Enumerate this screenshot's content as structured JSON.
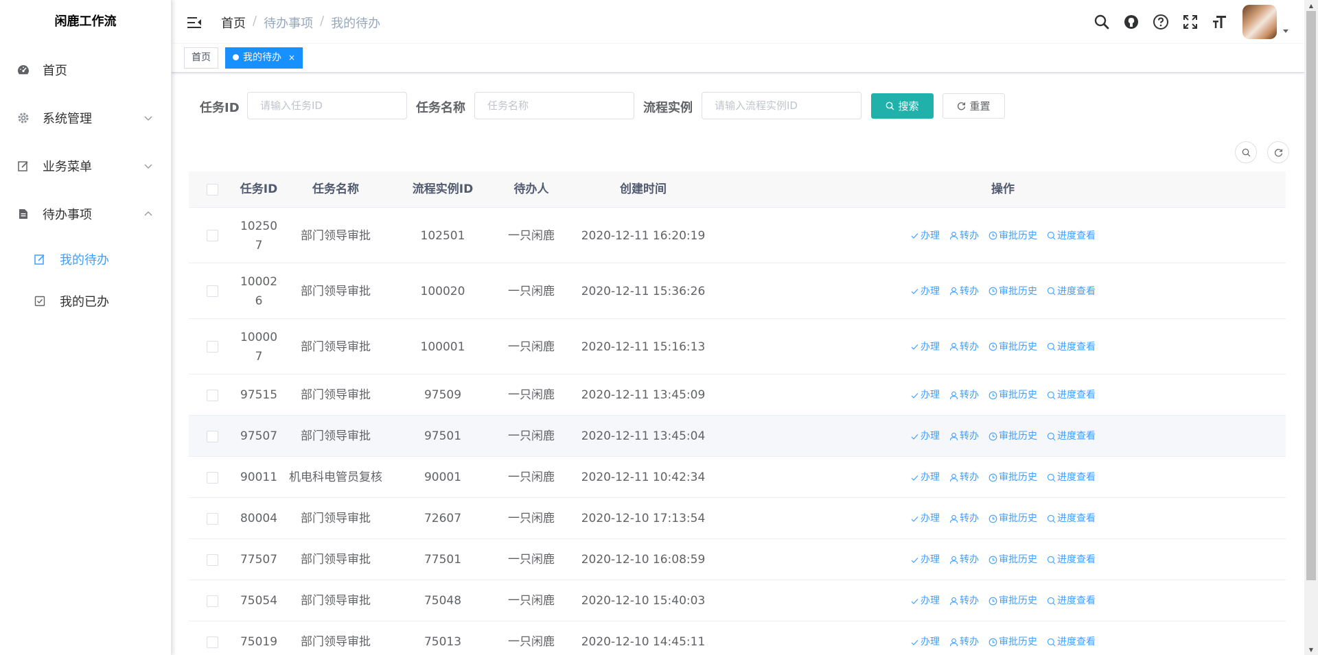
{
  "app": {
    "title": "闲鹿工作流"
  },
  "sidebar": {
    "items": [
      {
        "label": "首页"
      },
      {
        "label": "系统管理"
      },
      {
        "label": "业务菜单"
      },
      {
        "label": "待办事项"
      }
    ],
    "sub_items": [
      {
        "label": "我的待办",
        "active": true
      },
      {
        "label": "我的已办",
        "active": false
      }
    ]
  },
  "breadcrumb": [
    "首页",
    "待办事项",
    "我的待办"
  ],
  "tags": {
    "home": "首页",
    "active": "我的待办",
    "close": "×"
  },
  "search": {
    "task_id_label": "任务ID",
    "task_id_placeholder": "请输入任务ID",
    "task_name_label": "任务名称",
    "task_name_placeholder": "任务名称",
    "proc_inst_label": "流程实例",
    "proc_inst_placeholder": "请输入流程实例ID",
    "search_button": "搜索",
    "reset_button": "重置"
  },
  "table": {
    "headers": {
      "task_id": "任务ID",
      "task_name": "任务名称",
      "proc_inst_id": "流程实例ID",
      "assignee": "待办人",
      "create_time": "创建时间",
      "actions": "操作"
    },
    "action_labels": {
      "handle": "办理",
      "transfer": "转办",
      "history": "审批历史",
      "progress": "进度查看"
    },
    "rows": [
      {
        "task_id_lines": [
          "10250",
          "7"
        ],
        "task_name": "部门领导审批",
        "proc_inst_id": "102501",
        "assignee": "一只闲鹿",
        "create_time": "2020-12-11 16:20:19"
      },
      {
        "task_id_lines": [
          "10002",
          "6"
        ],
        "task_name": "部门领导审批",
        "proc_inst_id": "100020",
        "assignee": "一只闲鹿",
        "create_time": "2020-12-11 15:36:26"
      },
      {
        "task_id_lines": [
          "10000",
          "7"
        ],
        "task_name": "部门领导审批",
        "proc_inst_id": "100001",
        "assignee": "一只闲鹿",
        "create_time": "2020-12-11 15:16:13"
      },
      {
        "task_id_lines": [
          "97515"
        ],
        "task_name": "部门领导审批",
        "proc_inst_id": "97509",
        "assignee": "一只闲鹿",
        "create_time": "2020-12-11 13:45:09"
      },
      {
        "task_id_lines": [
          "97507"
        ],
        "task_name": "部门领导审批",
        "proc_inst_id": "97501",
        "assignee": "一只闲鹿",
        "create_time": "2020-12-11 13:45:04"
      },
      {
        "task_id_lines": [
          "90011"
        ],
        "task_name": "机电科电管员复核",
        "proc_inst_id": "90001",
        "assignee": "一只闲鹿",
        "create_time": "2020-12-11 10:42:34"
      },
      {
        "task_id_lines": [
          "80004"
        ],
        "task_name": "部门领导审批",
        "proc_inst_id": "72607",
        "assignee": "一只闲鹿",
        "create_time": "2020-12-10 17:13:54"
      },
      {
        "task_id_lines": [
          "77507"
        ],
        "task_name": "部门领导审批",
        "proc_inst_id": "77501",
        "assignee": "一只闲鹿",
        "create_time": "2020-12-10 16:08:59"
      },
      {
        "task_id_lines": [
          "75054"
        ],
        "task_name": "部门领导审批",
        "proc_inst_id": "75048",
        "assignee": "一只闲鹿",
        "create_time": "2020-12-10 15:40:03"
      },
      {
        "task_id_lines": [
          "75019"
        ],
        "task_name": "部门领导审批",
        "proc_inst_id": "75013",
        "assignee": "一只闲鹿",
        "create_time": "2020-12-10 14:45:11"
      }
    ]
  },
  "colors": {
    "primary": "#409eff",
    "tag_active": "#1890ff",
    "search_button": "#20b2aa"
  }
}
